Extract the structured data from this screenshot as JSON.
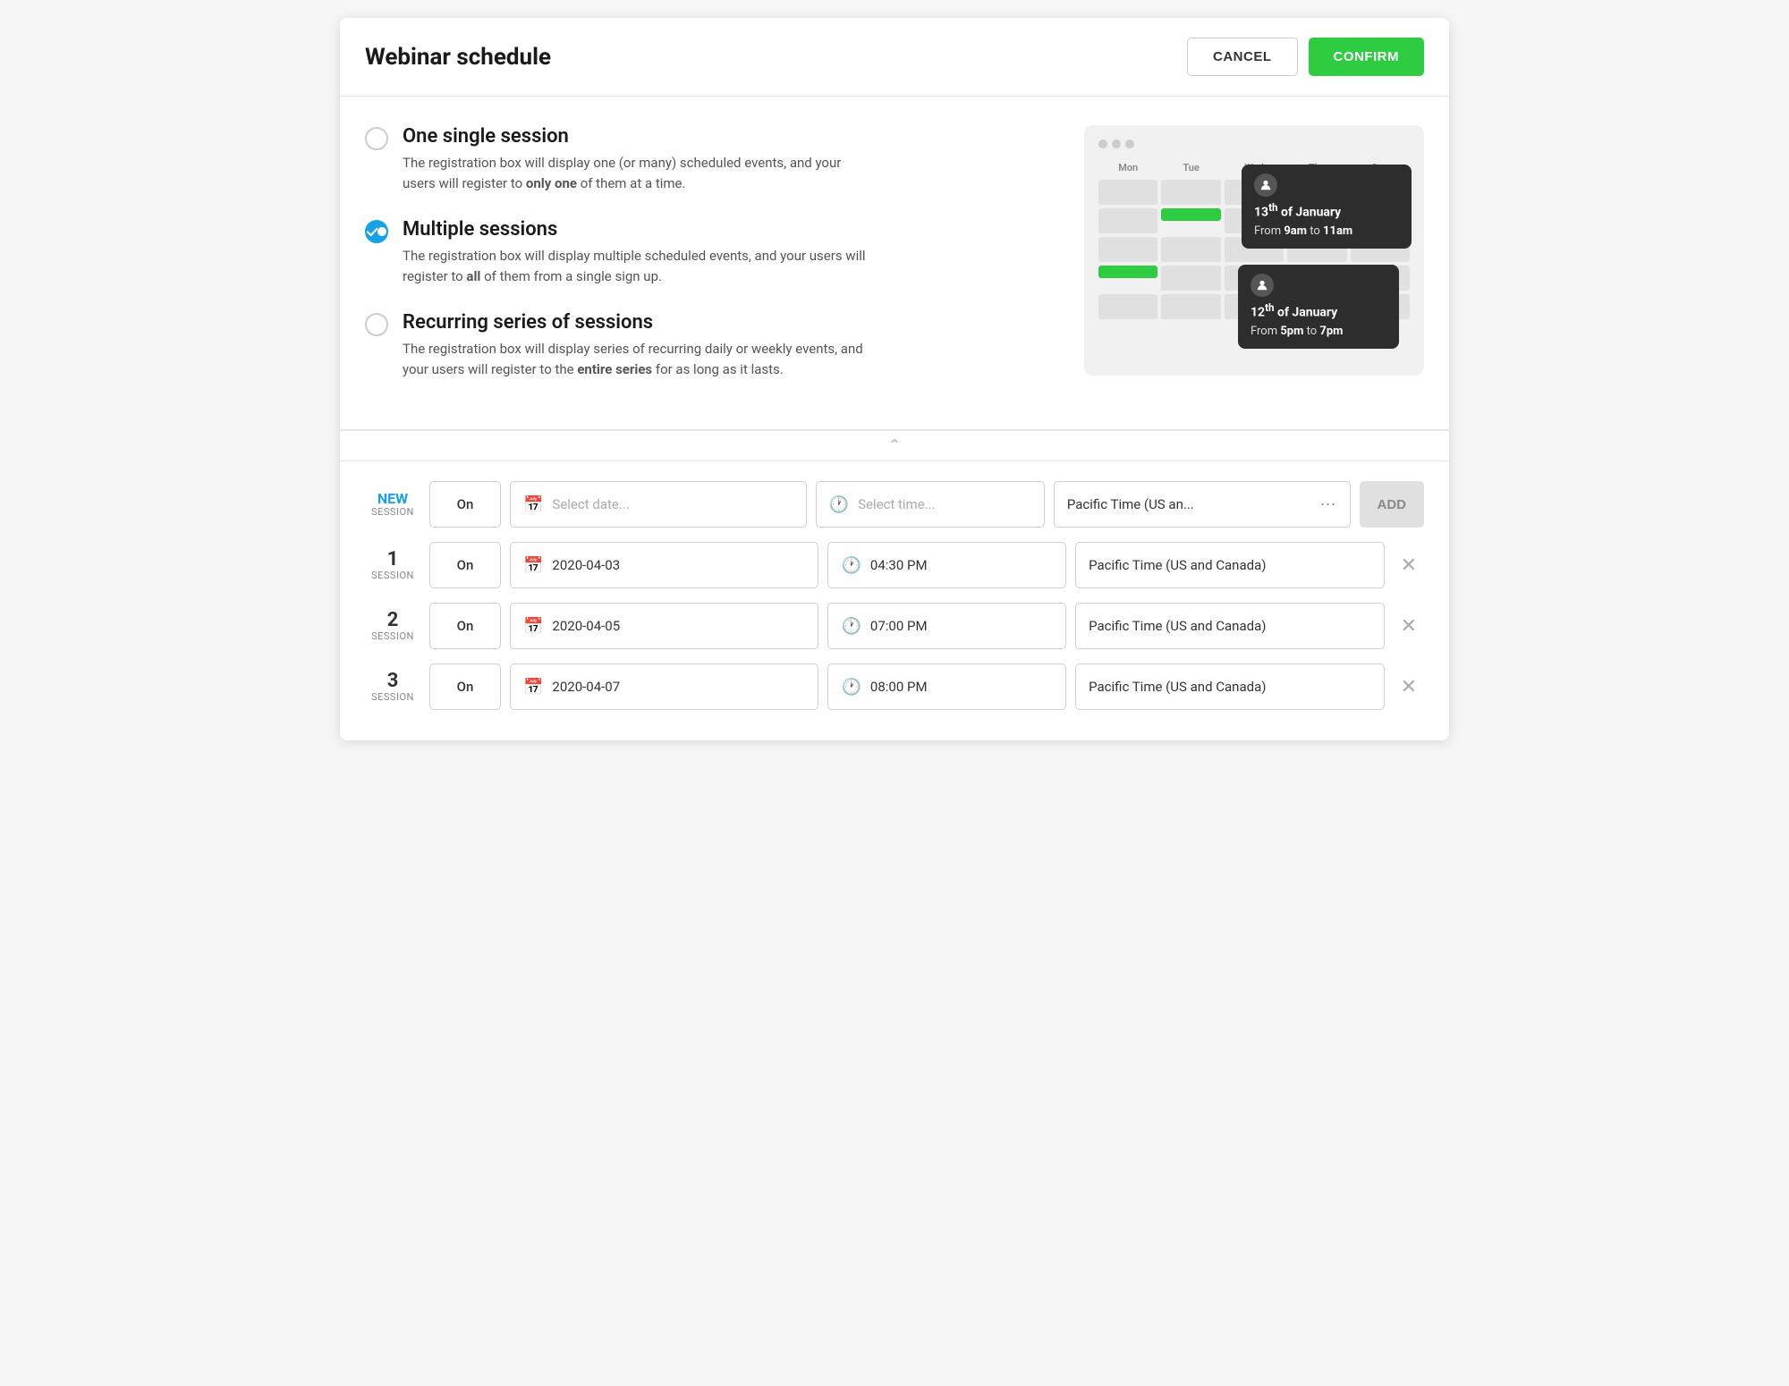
{
  "header": {
    "title": "Webinar schedule",
    "cancel_label": "CANCEL",
    "confirm_label": "CONFIRM"
  },
  "options": [
    {
      "id": "single",
      "label": "One single session",
      "description_parts": [
        {
          "text": "The registration box will display one (or many) scheduled events, and your users will register to "
        },
        {
          "text": "only one",
          "bold": true
        },
        {
          "text": " of them at a time."
        }
      ],
      "selected": false
    },
    {
      "id": "multiple",
      "label": "Multiple sessions",
      "description_parts": [
        {
          "text": "The registration box will display multiple scheduled events, and your users will register to "
        },
        {
          "text": "all",
          "bold": true
        },
        {
          "text": " of them from a single sign up."
        }
      ],
      "selected": true
    },
    {
      "id": "recurring",
      "label": "Recurring series of sessions",
      "description_parts": [
        {
          "text": "The registration box will display series of recurring daily or weekly events, and your users will register to the "
        },
        {
          "text": "entire series",
          "bold": true
        },
        {
          "text": " for as long as it lasts."
        }
      ],
      "selected": false
    }
  ],
  "preview": {
    "days": [
      "Mon",
      "Tue",
      "Wed",
      "Thu",
      "Sun"
    ],
    "tooltip_upper": {
      "date": "13th of January",
      "time_label": "From",
      "time_start": "9am",
      "time_to": "to",
      "time_end": "11am"
    },
    "tooltip_lower": {
      "date": "12th of January",
      "time_label": "From",
      "time_start": "5pm",
      "time_to": "to",
      "time_end": "7pm"
    }
  },
  "new_session": {
    "number_label": "NEW",
    "sub_label": "SESSION",
    "status": "On",
    "date_placeholder": "Select date...",
    "time_placeholder": "Select time...",
    "timezone": "Pacific Time (US an...",
    "add_label": "ADD"
  },
  "sessions": [
    {
      "number": "1",
      "sub_label": "SESSION",
      "status": "On",
      "date": "2020-04-03",
      "time": "04:30 PM",
      "timezone": "Pacific Time (US and Canada)"
    },
    {
      "number": "2",
      "sub_label": "SESSION",
      "status": "On",
      "date": "2020-04-05",
      "time": "07:00 PM",
      "timezone": "Pacific Time (US and Canada)"
    },
    {
      "number": "3",
      "sub_label": "SESSION",
      "status": "On",
      "date": "2020-04-07",
      "time": "08:00 PM",
      "timezone": "Pacific Time (US and Canada)"
    }
  ]
}
